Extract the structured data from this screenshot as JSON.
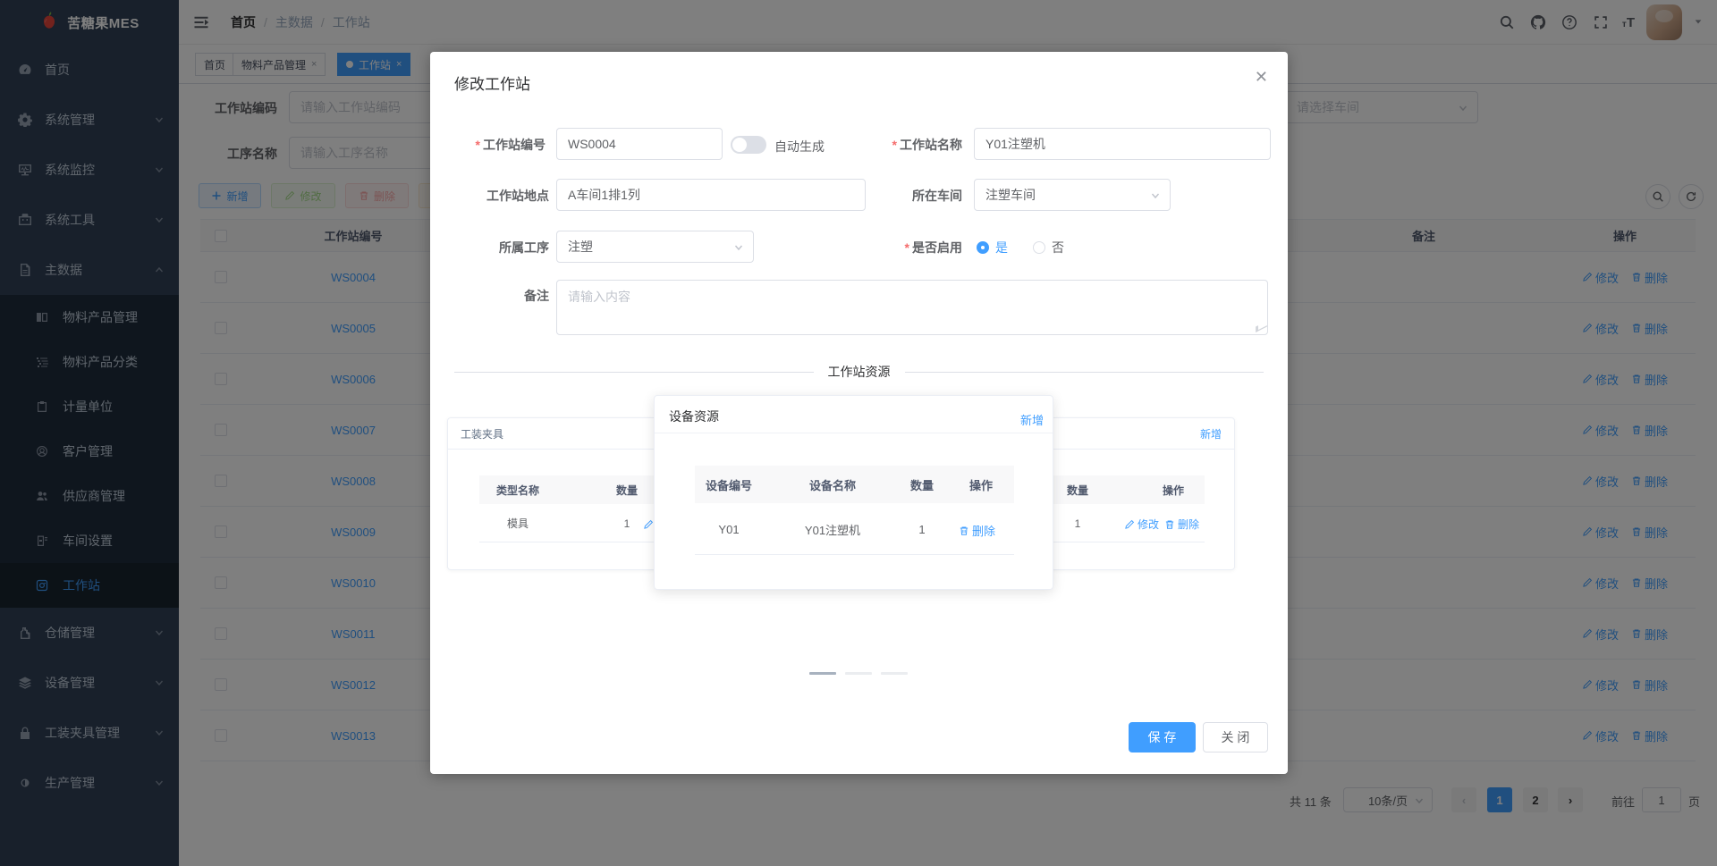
{
  "app": {
    "logo_title": "苦糖果MES"
  },
  "colors": {
    "accent": "#409EFF",
    "sidebar_bg": "#304156",
    "submenu_bg": "#1f2d3d",
    "danger": "#f56c6c"
  },
  "navbar": {
    "breadcrumb": [
      "首页",
      "主数据",
      "工作站"
    ],
    "separator": "/"
  },
  "tags": {
    "items": [
      {
        "label": "首页"
      },
      {
        "label": "物料产品管理"
      },
      {
        "label": "工作站"
      }
    ],
    "close_glyph": "×"
  },
  "sidebar": {
    "items": [
      {
        "label": "首页"
      },
      {
        "label": "系统管理"
      },
      {
        "label": "系统监控"
      },
      {
        "label": "系统工具"
      },
      {
        "label": "主数据",
        "children": [
          {
            "label": "物料产品管理"
          },
          {
            "label": "物料产品分类"
          },
          {
            "label": "计量单位"
          },
          {
            "label": "客户管理"
          },
          {
            "label": "供应商管理"
          },
          {
            "label": "车间设置"
          },
          {
            "label": "工作站"
          }
        ]
      },
      {
        "label": "仓储管理"
      },
      {
        "label": "设备管理"
      },
      {
        "label": "工装夹具管理"
      },
      {
        "label": "生产管理"
      }
    ]
  },
  "filters": {
    "station_code_label": "工作站编码",
    "station_code_placeholder": "请输入工作站编码",
    "process_name_label": "工序名称",
    "process_name_placeholder": "请输入工序名称",
    "workshop_placeholder": "请选择车间"
  },
  "toolbar": {
    "add": "新增",
    "edit": "修改",
    "delete": "删除"
  },
  "table": {
    "col_code": "工作站编号",
    "col_remark": "备注",
    "col_action": "操作",
    "rows": [
      "WS0004",
      "WS0005",
      "WS0006",
      "WS0007",
      "WS0008",
      "WS0009",
      "WS0010",
      "WS0011",
      "WS0012",
      "WS0013"
    ],
    "action_edit": "修改",
    "action_delete": "删除"
  },
  "pagination": {
    "total": "共 11 条",
    "page_size": "10条/页",
    "page1": "1",
    "page2": "2",
    "goto": "前往",
    "goto_value": "1",
    "unit": "页"
  },
  "modal": {
    "title": "修改工作站",
    "close_glyph": "✕",
    "code_label": "工作站编号",
    "code_value": "WS0004",
    "auto_label": "自动生成",
    "name_label": "工作站名称",
    "name_value": "Y01注塑机",
    "location_label": "工作站地点",
    "location_value": "A车间1排1列",
    "workshop_label": "所在车间",
    "workshop_value": "注塑车间",
    "process_label": "所属工序",
    "process_value": "注塑",
    "enabled_label": "是否启用",
    "enabled_yes": "是",
    "enabled_no": "否",
    "remark_label": "备注",
    "remark_placeholder": "请输入内容",
    "divider": "工作站资源",
    "fixture_card": {
      "title": "工装夹具",
      "col_type": "类型名称",
      "col_qty": "数量",
      "row_type": "模具",
      "row_qty": "1",
      "edit": "修改"
    },
    "device_card": {
      "title": "设备资源",
      "add": "新增",
      "col_code": "设备编号",
      "col_name": "设备名称",
      "col_qty": "数量",
      "col_action": "操作",
      "row_code": "Y01",
      "row_name": "Y01注塑机",
      "row_qty": "1",
      "delete": "删除"
    },
    "right_card": {
      "add": "新增",
      "col_qty": "数量",
      "col_action": "操作",
      "row_qty": "1",
      "edit": "修改",
      "delete": "删除"
    },
    "save": "保 存",
    "close": "关 闭"
  }
}
